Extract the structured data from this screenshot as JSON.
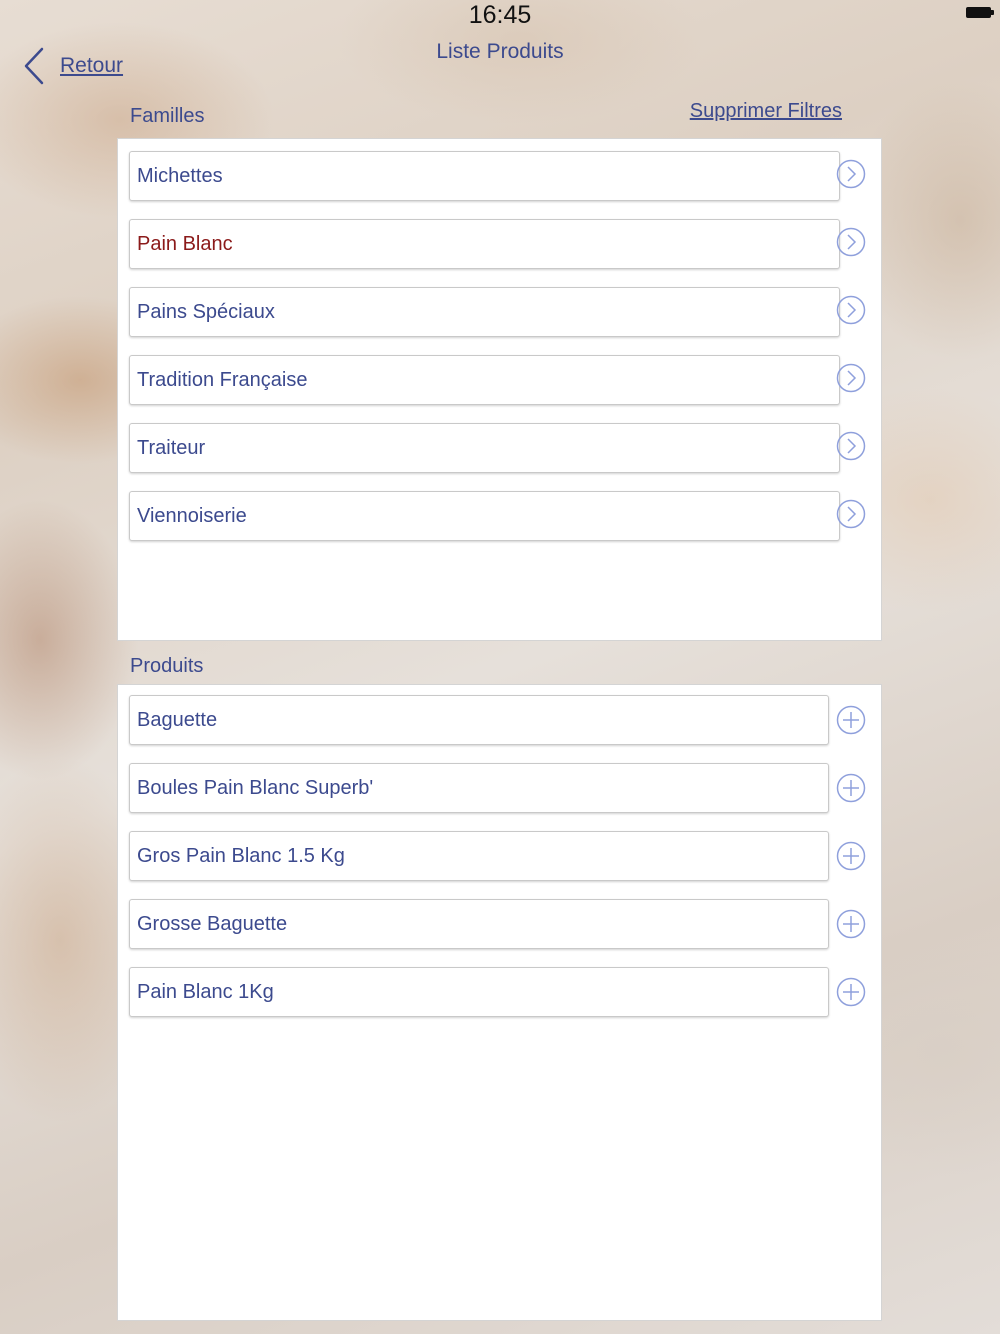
{
  "status_bar": {
    "time": "16:45"
  },
  "nav": {
    "back_label": "Retour",
    "title": "Liste Produits"
  },
  "familles": {
    "label": "Familles",
    "clear_filters_label": "Supprimer Filtres",
    "items": [
      {
        "label": "Michettes"
      },
      {
        "label": "Pain Blanc",
        "selected": true
      },
      {
        "label": "Pains Spéciaux"
      },
      {
        "label": "Tradition Française"
      },
      {
        "label": "Traiteur"
      },
      {
        "label": "Viennoiserie"
      }
    ],
    "item_icon": "chevron-right-circle-icon"
  },
  "produits": {
    "label": "Produits",
    "items": [
      {
        "label": "Baguette"
      },
      {
        "label": "Boules Pain Blanc Superb'"
      },
      {
        "label": "Gros Pain Blanc 1.5 Kg"
      },
      {
        "label": "Grosse Baguette"
      },
      {
        "label": "Pain Blanc 1Kg"
      }
    ],
    "item_icon": "plus-circle-icon"
  },
  "colors": {
    "text_primary": "#3c4a8e",
    "text_selected": "#8b1a1a",
    "icon_stroke": "#8fa0dc"
  }
}
